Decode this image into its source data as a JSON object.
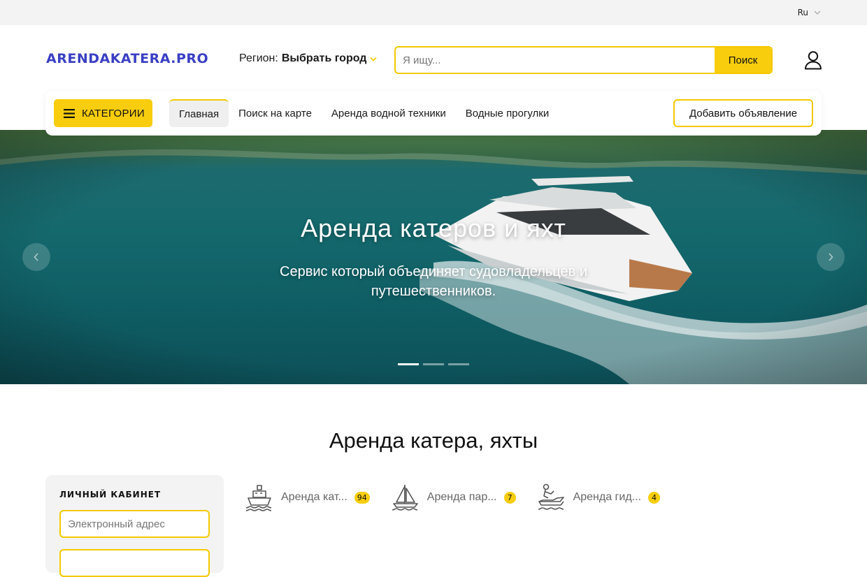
{
  "topbar": {
    "language": "Ru"
  },
  "header": {
    "logo_text": "ARENDAKATERA.PRO",
    "region_label": "Регион:",
    "region_value": "Выбрать город",
    "search_placeholder": "Я ищу...",
    "search_button": "Поиск"
  },
  "nav": {
    "categories_button": "КАТЕГОРИИ",
    "links": [
      {
        "label": "Главная",
        "active": true
      },
      {
        "label": "Поиск на карте"
      },
      {
        "label": "Аренда водной техники"
      },
      {
        "label": "Водные прогулки"
      }
    ],
    "add_listing": "Добавить объявление"
  },
  "hero": {
    "title": "Аренда катеров и яхт",
    "subtitle": "Сервис который объединяет судовладельцев и путешественников.",
    "slides": 3,
    "active_slide": 0
  },
  "section": {
    "title": "Аренда катера, яхты"
  },
  "cabinet": {
    "title": "ЛИЧНЫЙ КАБИНЕТ",
    "email_placeholder": "Электронный адрес"
  },
  "categories": [
    {
      "label": "Аренда кат...",
      "count": "94",
      "icon": "ship-icon"
    },
    {
      "label": "Аренда пар...",
      "count": "7",
      "icon": "sailboat-icon"
    },
    {
      "label": "Аренда гид...",
      "count": "4",
      "icon": "jet-ski-icon"
    }
  ],
  "colors": {
    "accent": "#f7cd0e",
    "logo": "#3a3fc4",
    "sea": "#14696d"
  }
}
